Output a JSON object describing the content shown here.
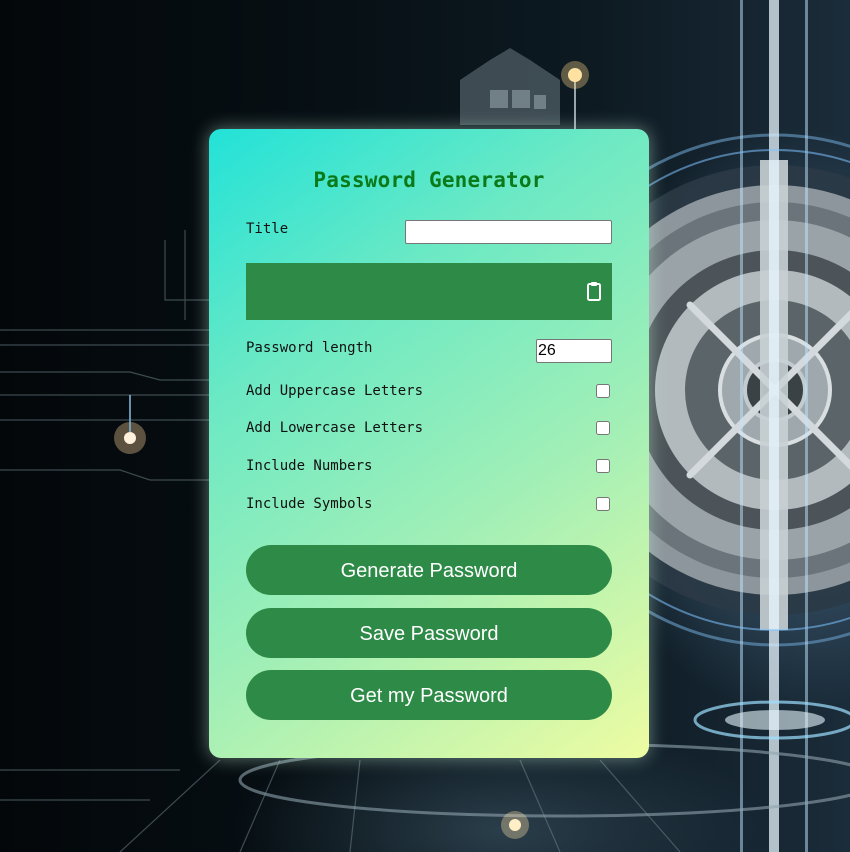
{
  "app": {
    "title": "Password Generator"
  },
  "form": {
    "title_label": "Title",
    "title_value": "",
    "password_value": "",
    "length_label": "Password length",
    "length_value": "26",
    "options": [
      {
        "label": "Add Uppercase Letters",
        "checked": false
      },
      {
        "label": "Add Lowercase Letters",
        "checked": false
      },
      {
        "label": "Include Numbers",
        "checked": false
      },
      {
        "label": "Include Symbols",
        "checked": false
      }
    ]
  },
  "buttons": {
    "generate": "Generate Password",
    "save": "Save Password",
    "get": "Get my Password"
  },
  "icons": {
    "copy": "clipboard-icon"
  },
  "colors": {
    "accent": "#2e8b47",
    "title": "#0b7a18",
    "card_gradient_start": "#22e2d8",
    "card_gradient_end": "#eefca2"
  }
}
